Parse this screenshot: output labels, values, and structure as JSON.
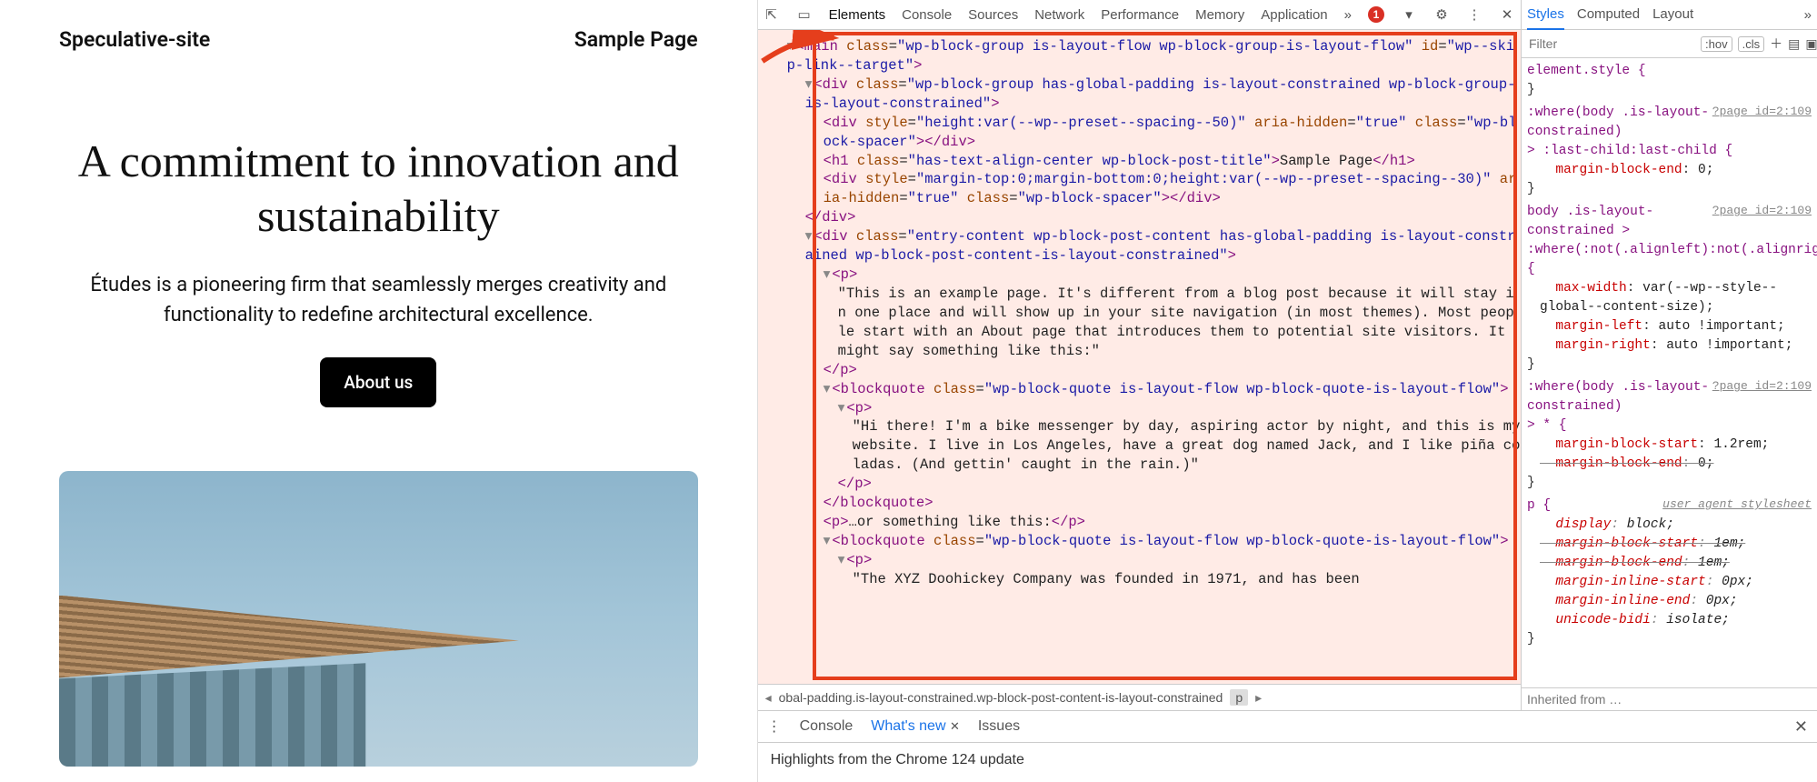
{
  "site": {
    "title": "Speculative-site",
    "nav": [
      "Sample Page"
    ],
    "hero_title": "A commitment to innovation and sustainability",
    "hero_sub": "Études is a pioneering firm that seamlessly merges creativity and functionality to redefine architectural excellence.",
    "cta": "About us"
  },
  "devtools": {
    "tabs": [
      "Elements",
      "Console",
      "Sources",
      "Network",
      "Performance",
      "Memory",
      "Application"
    ],
    "tabs_more_icon": "»",
    "errors_count": "1",
    "settings_icon": "gear",
    "dom": {
      "lines": [
        {
          "ind": 1,
          "tri": "▾",
          "raw": "<main class=\"wp-block-group is-layout-flow wp-block-group-is-layout-flow\" id=\"wp--skip-link--target\">"
        },
        {
          "ind": 2,
          "tri": "▾",
          "raw": "<div class=\"wp-block-group has-global-padding is-layout-constrained wp-block-group-is-layout-constrained\">"
        },
        {
          "ind": 3,
          "tri": "",
          "raw": "<div style=\"height:var(--wp--preset--spacing--50)\" aria-hidden=\"true\" class=\"wp-block-spacer\"></div>"
        },
        {
          "ind": 3,
          "tri": "",
          "raw": "<h1 class=\"has-text-align-center wp-block-post-title\">Sample Page</h1>"
        },
        {
          "ind": 3,
          "tri": "",
          "raw": "<div style=\"margin-top:0;margin-bottom:0;height:var(--wp--preset--spacing--30)\" aria-hidden=\"true\" class=\"wp-block-spacer\"></div>"
        },
        {
          "ind": 2,
          "tri": "",
          "raw": "</div>"
        },
        {
          "ind": 2,
          "tri": "▾",
          "raw": "<div class=\"entry-content wp-block-post-content has-global-padding is-layout-constrained wp-block-post-content-is-layout-constrained\">"
        },
        {
          "ind": 3,
          "tri": "▾",
          "raw": "<p>"
        },
        {
          "ind": 4,
          "tri": "",
          "text": "\"This is an example page. It's different from a blog post because it will stay in one place and will show up in your site navigation (in most themes). Most people start with an About page that introduces them to potential site visitors. It might say something like this:\""
        },
        {
          "ind": 3,
          "tri": "",
          "raw": "</p>"
        },
        {
          "ind": 3,
          "tri": "▾",
          "raw": "<blockquote class=\"wp-block-quote is-layout-flow wp-block-quote-is-layout-flow\">"
        },
        {
          "ind": 4,
          "tri": "▾",
          "raw": "<p>"
        },
        {
          "ind": 5,
          "tri": "",
          "text": "\"Hi there! I'm a bike messenger by day, aspiring actor by night, and this is my website. I live in Los Angeles, have a great dog named Jack, and I like piña coladas. (And gettin' caught in the rain.)\""
        },
        {
          "ind": 4,
          "tri": "",
          "raw": "</p>"
        },
        {
          "ind": 3,
          "tri": "",
          "raw": "</blockquote>"
        },
        {
          "ind": 3,
          "tri": "",
          "raw": "<p>…or something like this:</p>"
        },
        {
          "ind": 3,
          "tri": "▾",
          "raw": "<blockquote class=\"wp-block-quote is-layout-flow wp-block-quote-is-layout-flow\">"
        },
        {
          "ind": 4,
          "tri": "▾",
          "raw": "<p>"
        },
        {
          "ind": 5,
          "tri": "",
          "text": "\"The XYZ Doohickey Company was founded in 1971, and has been"
        }
      ]
    },
    "crumbs": {
      "long": "obal-padding.is-layout-constrained.wp-block-post-content-is-layout-constrained",
      "sel": "p"
    },
    "styles": {
      "tabs": [
        "Styles",
        "Computed",
        "Layout"
      ],
      "filter_placeholder": "Filter",
      "hov": ":hov",
      "cls": ".cls",
      "rules": [
        {
          "selector": "element.style {",
          "src": "",
          "props": [],
          "close": "}"
        },
        {
          "selector": ":where(body .is-layout-constrained)",
          "src": "?page_id=2:109",
          "props": [
            {
              "prefix": "> :last-child:last-child {"
            },
            {
              "p": "margin-block-end",
              "v": "0;"
            }
          ],
          "close": "}"
        },
        {
          "selector": "body .is-layout-constrained >",
          "src": "?page_id=2:109",
          "props": [
            {
              "prefix": ":where(:not(.alignleft):not(.alignright):not(.alignfull)) {"
            },
            {
              "p": "max-width",
              "v": "var(--wp--style--global--content-size);"
            },
            {
              "p": "margin-left",
              "v": "auto !important;"
            },
            {
              "p": "margin-right",
              "v": "auto !important;"
            }
          ],
          "close": "}"
        },
        {
          "selector": ":where(body .is-layout-constrained)",
          "src": "?page_id=2:109",
          "props": [
            {
              "prefix": "> * {"
            },
            {
              "p": "margin-block-start",
              "v": "1.2rem;"
            },
            {
              "p": "margin-block-end",
              "v": "0;",
              "strike": true
            }
          ],
          "close": "}"
        },
        {
          "selector": "p {",
          "src": "user agent stylesheet",
          "ua": true,
          "props": [
            {
              "p": "display",
              "v": "block;",
              "ital": true
            },
            {
              "p": "margin-block-start",
              "v": "1em;",
              "strike": true,
              "ital": true
            },
            {
              "p": "margin-block-end",
              "v": "1em;",
              "strike": true,
              "ital": true
            },
            {
              "p": "margin-inline-start",
              "v": "0px;",
              "ital": true
            },
            {
              "p": "margin-inline-end",
              "v": "0px;",
              "ital": true
            },
            {
              "p": "unicode-bidi",
              "v": "isolate;",
              "ital": true
            }
          ],
          "close": "}"
        }
      ],
      "inherited": "Inherited from …"
    },
    "drawer": {
      "tabs": [
        "Console",
        "What's new",
        "Issues"
      ],
      "active": 1,
      "body": "Highlights from the Chrome 124 update"
    }
  }
}
